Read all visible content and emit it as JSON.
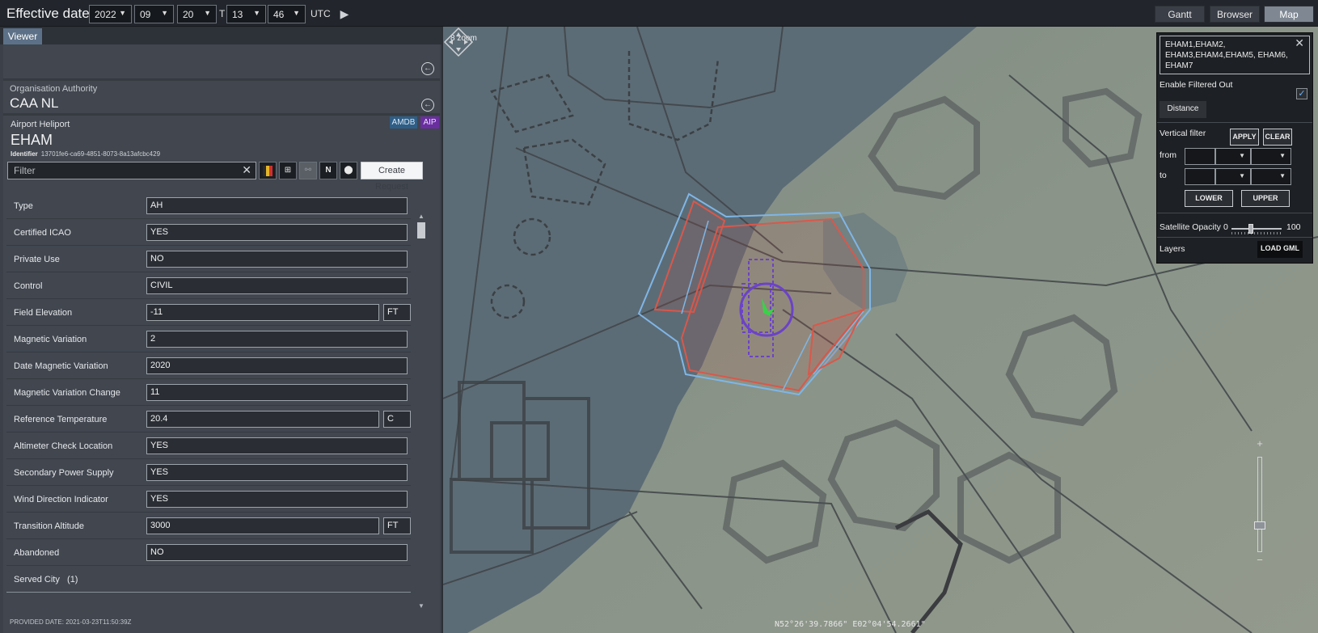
{
  "header": {
    "title": "Effective date",
    "year": "2022",
    "month": "09",
    "day": "20",
    "t_sep": "T",
    "hour": "13",
    "minute": "46",
    "tz": "UTC",
    "modes": {
      "gantt": "Gantt",
      "browser": "Browser",
      "map": "Map"
    },
    "active_mode": "Map"
  },
  "viewer": {
    "tab": "Viewer",
    "org_label": "Organisation Authority",
    "org_value": "CAA NL",
    "ah_label": "Airport Heliport",
    "ah_value": "EHAM",
    "identifier_label": "Identifier",
    "identifier": "13701fe6-ca69-4851-8073-8a13afcbc429",
    "badges": {
      "amdb": "AMDB",
      "aip": "AIP"
    },
    "filter_placeholder": "Filter",
    "n_button": "N",
    "create_request": "Create Request",
    "rows": [
      {
        "label": "Type",
        "value": "AH"
      },
      {
        "label": "Certified ICAO",
        "value": "YES"
      },
      {
        "label": "Private Use",
        "value": "NO"
      },
      {
        "label": "Control",
        "value": "CIVIL"
      },
      {
        "label": "Field Elevation",
        "value": "-11",
        "unit": "FT"
      },
      {
        "label": "Magnetic Variation",
        "value": "2"
      },
      {
        "label": "Date Magnetic Variation",
        "value": "2020"
      },
      {
        "label": "Magnetic Variation Change",
        "value": "11"
      },
      {
        "label": "Reference Temperature",
        "value": "20.4",
        "unit": "C"
      },
      {
        "label": "Altimeter Check Location",
        "value": "YES"
      },
      {
        "label": "Secondary Power Supply",
        "value": "YES"
      },
      {
        "label": "Wind Direction Indicator",
        "value": "YES"
      },
      {
        "label": "Transition Altitude",
        "value": "3000",
        "unit": "FT"
      },
      {
        "label": "Abandoned",
        "value": "NO"
      }
    ],
    "served_city": "Served City",
    "served_city_count": "(1)",
    "provided_date": "PROVIDED DATE: 2021-03-23T11:50:39Z"
  },
  "map": {
    "zoom_label": "8 zoom",
    "coordinate": "N52°26'39.7866\" E02°04'54.2661\"",
    "filter_panel": {
      "search_text": "EHAM1,EHAM2, EHAM3,EHAM4,EHAM5, EHAM6, EHAM7",
      "enable_filtered_out": "Enable Filtered Out",
      "enable_filtered_out_checked": true,
      "distance": "Distance",
      "vertical_filter": "Vertical filter",
      "apply": "APPLY",
      "clear": "CLEAR",
      "from": "from",
      "to": "to",
      "lower": "LOWER",
      "upper": "UPPER",
      "satellite_opacity": "Satellite Opacity",
      "opacity_min": "0",
      "opacity_max": "100",
      "layers": "Layers",
      "load_gml": "LOAD GML"
    }
  },
  "colors": {
    "airspace_blue": "#7fb6e6",
    "airspace_red": "#d9584b",
    "airport_purple": "#6b43c7",
    "aircraft_green": "#3bd14a"
  }
}
